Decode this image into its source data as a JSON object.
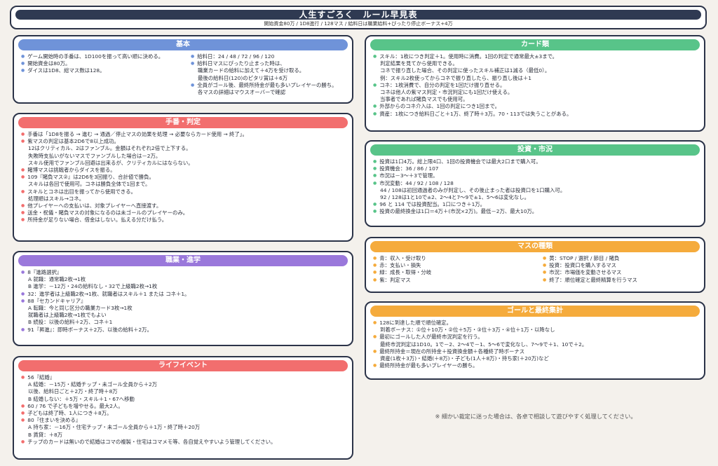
{
  "header": {
    "title": "人生すごろく　ルール早見表",
    "subtitle": "開始資金80万 / 1D8進行 / 128マス / 給料日は職業給料+ぴったり停止ボーナス+4万"
  },
  "colors": {
    "blue": "#6f93d9",
    "red": "#f26e6e",
    "purple": "#9a78db",
    "green": "#58c489",
    "orange": "#f5ab3c",
    "border": "#2b3348"
  },
  "basic": {
    "title": "基本",
    "left": [
      "ゲーム開始時の手番は、1D100を振って高い順に決める。",
      "開始資金は80万。",
      "ダイスは1D8、総マス数は128。"
    ],
    "right": [
      "給料日：24 / 48 / 72 / 96 / 120",
      "給料日マスにぴったり止まった時は、",
      "職業カードの給料に加えて＋4万を受け取る。",
      "最後の給料日(120)のピタリ賞は＋6万",
      "全員がゴール後、最終所持金が最も多いプレイヤーの勝ち。",
      "各マスの詳細はマウスオーバーで確認"
    ]
  },
  "turn": {
    "title": "手番・判定",
    "lines": [
      "手番は「1D8を振る → 進む → 通過／停止マスの効果を処理 → 必要ならカード使用 → 終了」。",
      "紫マスの判定は基本2D6で8以上成功。",
      "12はクリティカル、2はファンブル。金額はそれぞれ2倍で上下する。",
      "失敗時支払いがないマスでファンブルした場合は－2万。",
      "スキル使用でファンブル回避は出来るが、クリティカルにはならない。",
      "賭博マスは挑戦者からダイスを振る。",
      "109『賭負マス②』は2D6を3回振り、合計値で勝負。",
      "スキルは各回で使用可。コネは勝負全体で1回まで。",
      "スキルとコネは出目を振ってから使用できる。",
      "処理順はスキル→コネ。",
      "他プレイヤーへの支払いは、対象プレイヤーへ直接渡す。",
      "送金・祝儀・賭負マスの対象になるのは未ゴールのプレイヤーのみ。",
      "所持金が足りない場合、借金はしない。払える分だけ払う。"
    ]
  },
  "career": {
    "title": "職業・進学",
    "lines": [
      "8『進路選択』",
      "A 就職：通常職2枚→1枚",
      "B 進学：－12万・24の給料なし・32で上級職2枚→1枚",
      "32：進学者は上級職2枚→1枚、就職者はスキル＋1 または コネ＋1。",
      "88『セカンドキャリア』",
      "A 転職：今と同じ区分の職業カード3枚→1枚",
      "就職者は上級職2枚→1枚でもよい",
      "B 続投：以後の給料＋2万、コネ＋1",
      "91『昇進』：即時ボーナス＋2万、以後の給料＋2万。"
    ]
  },
  "life": {
    "title": "ライフイベント",
    "lines": [
      "56『結婚』",
      "A 結婚：－15万・結婚チップ・未ゴール全員から＋2万",
      "以後、給料日ごと＋2万・終了時＋8万",
      "B 結婚しない：＋5万・スキル＋1・67へ移動",
      "60 / 76 で子どもを増やせる。最大2人。",
      "子どもは終了時、1人につき＋8万。",
      "80『住まいを決める』",
      "A 持ち家：－16万・住宅チップ・未ゴール全員から＋1万・終了時＋20万",
      "B 賃貸：＋8万",
      "チップのカードは無いので結婚はコマの複製・住宅はコマメモ等、各自覚えやすいよう管理してください。"
    ]
  },
  "cards": {
    "title": "カード類",
    "lines": [
      "スキル：1枚につき判定＋1。使用時に消費。1回の判定で通常最大±3まで。",
      "判定結果を見てから使用できる。",
      "コネで振り直した場合、その判定に使ったスキル補正は1減る（最低0）。",
      "例：スキル2枚使ってからコネで振り直したら、振り直し後は＋1",
      "コネ：1枚消費で、自分の判定を1回だけ振り直せる。",
      "コネは他人の紫マス判定・市況判定にも1回だけ使える。",
      "当事者であれば賭負マスでも使用可。",
      "外部からのコネ介入は、1回の判定につき1回まで。",
      "資産：1枚につき給料日ごと＋1万、終了時＋3万。70・113では失うことがある。"
    ]
  },
  "invest": {
    "title": "投資・市況",
    "lines": [
      "投資は1口4万。総上限4口、1回の投資機会では最大2口まで購入可。",
      "投資機会：36 / 86 / 107",
      "市況は－3～＋3で管理。",
      "市況変動：44 / 92 / 108 / 128",
      "44 / 108は初回通過者のみが判定し、その後止まった者は投資口を1口購入可。",
      "92 / 128は1と10で±2、2～4と7～9で±1、5～6は変化なし。",
      "96 と 114 では投資配当。1口につき＋1万。",
      "投資の最終換金は1口＝4万＋(市況×2万)。最低－2万、最大10万。"
    ]
  },
  "squares": {
    "title": "マスの種類",
    "left": [
      "青：収入・受け取り",
      "赤：支払い・損失",
      "緑：成長・取得・分岐",
      "紫：判定マス"
    ],
    "right": [
      "黄：STOP / 選択 / 節目 / 賭負",
      "投資：投資口を購入するマス",
      "市況：市場価を変動させるマス",
      "終了：順位確定と最終精算を行うマス"
    ]
  },
  "goal": {
    "title": "ゴールと最終集計",
    "lines": [
      "128に到達した順で順位確定。",
      "到着ボーナス：①位＋10万・②位＋5万・③位＋3万・④位＋1万・以降なし",
      "最初にゴールした人が最終市況判定を行う。",
      "最終市況判定は1D10。1で－2、2～4で－1、5～6で変化なし、7～9で＋1、10で＋2。",
      "最終所持金＝現在の所持金＋投資換金額＋各種終了時ボーナス",
      "資産(1枚＋3万)・結婚(＋8万)・子ども(1人＋8万)・持ち家(＋20万)など",
      "最終所持金が最も多いプレイヤーの勝ち。"
    ]
  },
  "footer_note": "※ 細かい裁定に迷った場合は、各卓で相談して遊びやすく処理してください。"
}
